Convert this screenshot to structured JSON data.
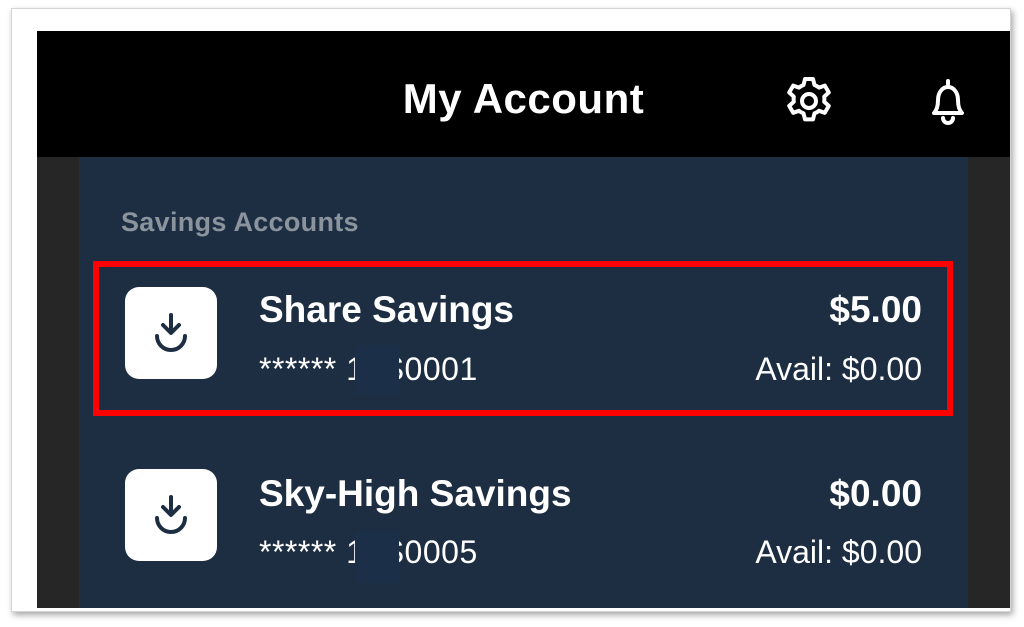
{
  "header": {
    "title": "My Account",
    "settings_icon": "gear-icon",
    "notifications_icon": "bell-icon"
  },
  "section": {
    "label": "Savings Accounts"
  },
  "accounts": [
    {
      "name": "Share Savings",
      "number": "******  10S0001",
      "balance": "$5.00",
      "available": "Avail: $0.00",
      "icon": "deposit-arrow-icon",
      "highlighted": true
    },
    {
      "name": "Sky-High Savings",
      "number": "******  10S0005",
      "balance": "$0.00",
      "available": "Avail: $0.00",
      "icon": "deposit-arrow-icon",
      "highlighted": false
    }
  ],
  "colors": {
    "header_bg": "#000000",
    "panel_bg": "#1d2e43",
    "highlight": "#ff0000",
    "section_label": "#8b939d"
  }
}
